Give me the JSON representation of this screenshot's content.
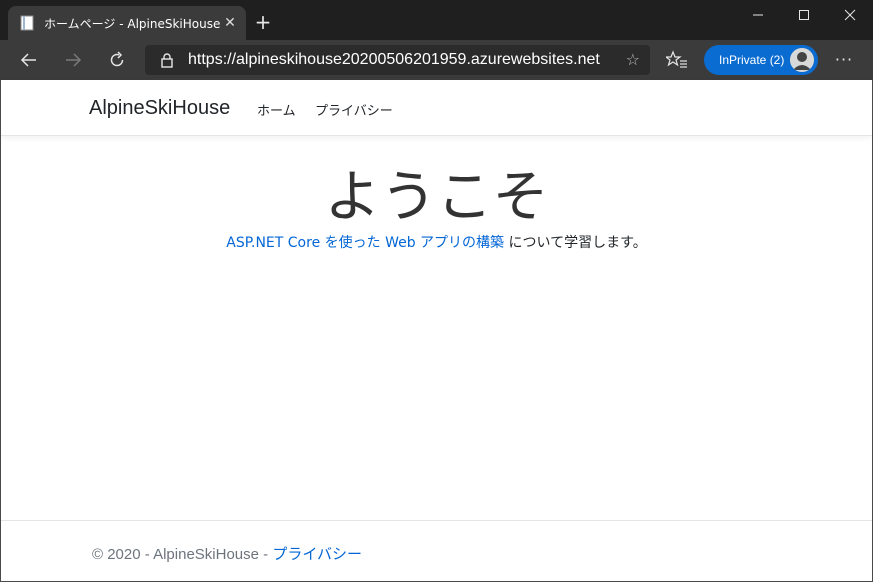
{
  "browser": {
    "tab_title": "ホームページ - AlpineSkiHouse",
    "url": "https://alpineskihouse20200506201959.azurewebsites.net",
    "inprivate_label": "InPrivate (2)",
    "colors": {
      "titlebar": "#1f1f1f",
      "toolbar": "#3b3b3b",
      "inprivate": "#0a6cd0"
    }
  },
  "site": {
    "brand": "AlpineSkiHouse",
    "nav": [
      {
        "label": "ホーム"
      },
      {
        "label": "プライバシー"
      }
    ]
  },
  "main": {
    "heading": "ようこそ",
    "lead_link": "ASP.NET Core を使った Web アプリの構築",
    "lead_suffix": " について学習します。"
  },
  "footer": {
    "copyright": "© 2020 - AlpineSkiHouse - ",
    "privacy_link": "プライバシー"
  },
  "colors": {
    "link": "#0366d6",
    "text": "#212529",
    "muted": "#6c757d"
  }
}
